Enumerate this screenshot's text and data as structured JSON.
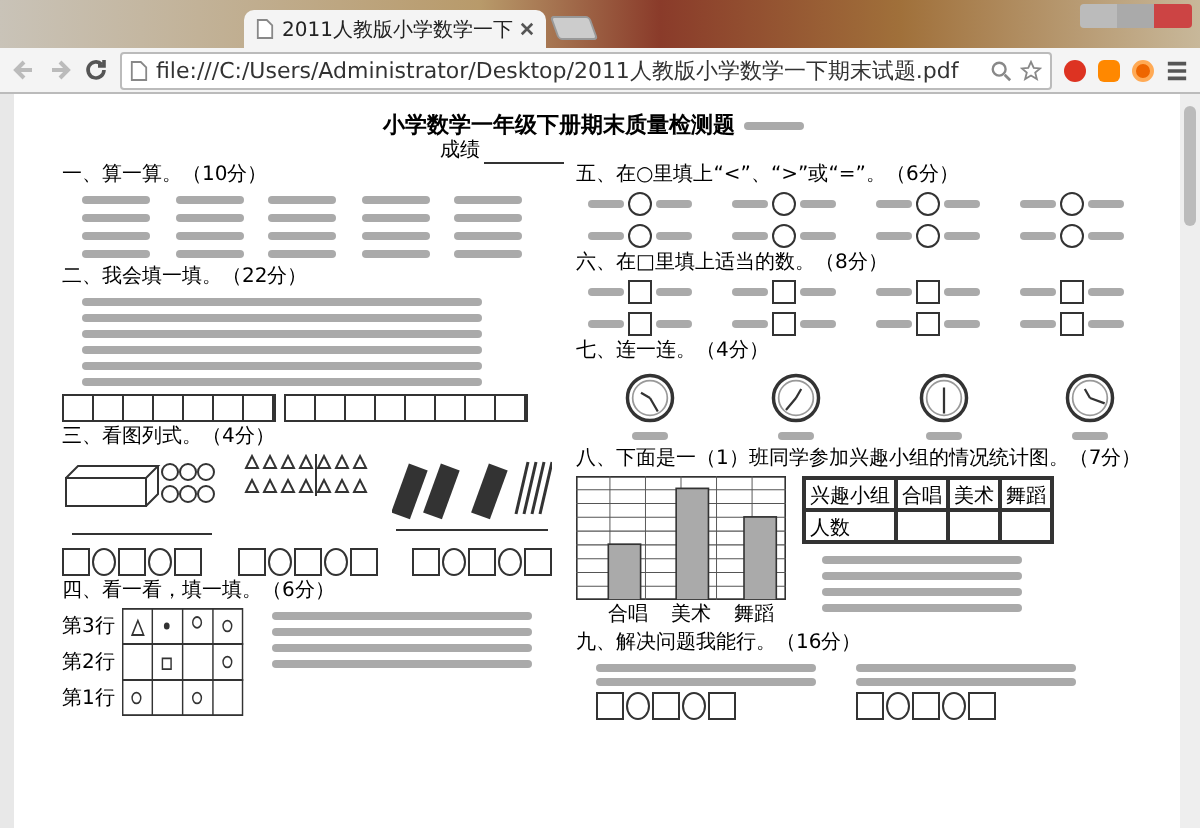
{
  "browser": {
    "tab_title": "2011人教版小学数学一下",
    "url": "file:///C:/Users/Administrator/Desktop/2011人教版小学数学一下期末试题.pdf"
  },
  "document": {
    "title": "小学数学一年级下册期末质量检测题",
    "score_label": "成绩",
    "left_sections": [
      {
        "heading": "一、算一算。（10分）",
        "kind": "calc"
      },
      {
        "heading": "二、我会填一填。（22分）",
        "kind": "fill"
      },
      {
        "heading": "三、看图列式。（4分）",
        "kind": "pictures"
      },
      {
        "heading": "四、看一看，填一填。（6分）",
        "kind": "grid",
        "row_labels": [
          "第3行",
          "第2行",
          "第1行"
        ]
      }
    ],
    "right_sections": [
      {
        "heading": "五、在○里填上“<”、“>”或“=”。（6分）",
        "kind": "compare"
      },
      {
        "heading": "六、在□里填上适当的数。（8分）",
        "kind": "boxes"
      },
      {
        "heading": "七、连一连。（4分）",
        "kind": "clocks"
      },
      {
        "heading": "八、下面是一（1）班同学参加兴趣小组的情况统计图。（7分）",
        "kind": "chart",
        "categories": [
          "合唱",
          "美术",
          "舞蹈"
        ],
        "table_header": [
          "兴趣小组",
          "合唱",
          "美术",
          "舞蹈"
        ],
        "table_row": "人数"
      },
      {
        "heading": "九、解决问题我能行。（16分）",
        "kind": "problems"
      }
    ]
  }
}
